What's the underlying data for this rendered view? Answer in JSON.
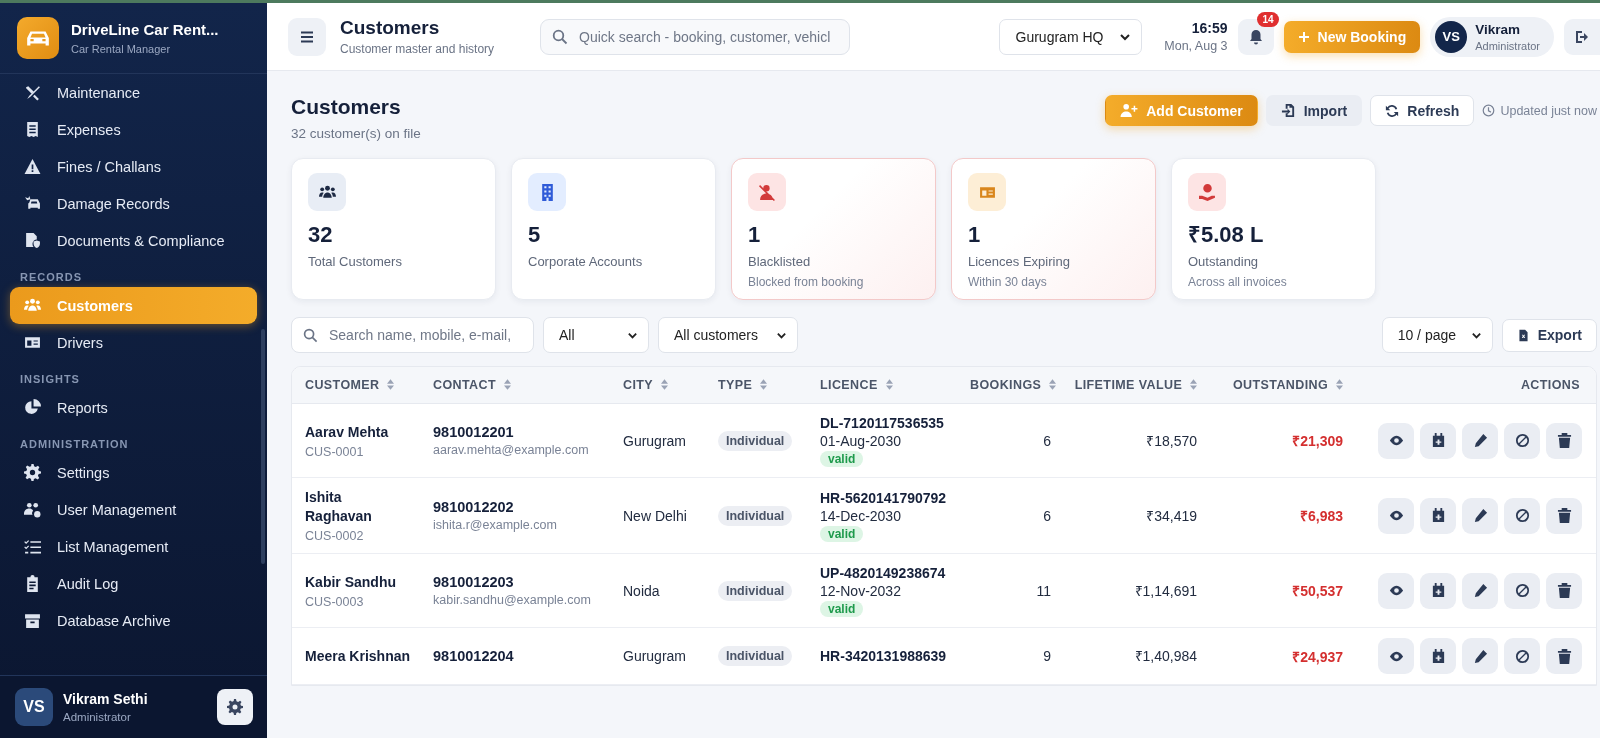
{
  "brand": {
    "title": "DriveLine Car Rent...",
    "subtitle": "Car Rental Manager"
  },
  "nav": [
    {
      "items": [
        {
          "label": "Maintenance",
          "selected": false
        },
        {
          "label": "Expenses",
          "selected": false
        },
        {
          "label": "Fines / Challans",
          "selected": false
        },
        {
          "label": "Damage Records",
          "selected": false
        },
        {
          "label": "Documents & Compliance",
          "selected": false
        }
      ]
    },
    {
      "heading": "RECORDS",
      "items": [
        {
          "label": "Customers",
          "selected": true
        },
        {
          "label": "Drivers",
          "selected": false
        }
      ]
    },
    {
      "heading": "INSIGHTS",
      "items": [
        {
          "label": "Reports",
          "selected": false
        }
      ]
    },
    {
      "heading": "ADMINISTRATION",
      "items": [
        {
          "label": "Settings",
          "selected": false
        },
        {
          "label": "User Management",
          "selected": false
        },
        {
          "label": "List Management",
          "selected": false
        },
        {
          "label": "Audit Log",
          "selected": false
        },
        {
          "label": "Database Archive",
          "selected": false
        }
      ]
    }
  ],
  "sidebar_user": {
    "initials": "VS",
    "name": "Vikram Sethi",
    "role": "Administrator"
  },
  "topbar": {
    "title": "Customers",
    "subtitle": "Customer master and history",
    "search_placeholder": "Quick search - booking, customer, vehicl",
    "location": "Gurugram HQ",
    "time": "16:59",
    "date": "Mon, Aug 3",
    "notifications": "14",
    "new_booking": "New Booking",
    "user": {
      "initials": "VS",
      "name": "Vikram",
      "role": "Administrator"
    }
  },
  "page": {
    "title": "Customers",
    "subtitle": "32 customer(s) on file",
    "add_button": "Add Customer",
    "import_button": "Import",
    "refresh_button": "Refresh",
    "updated": "Updated just now"
  },
  "stats": [
    {
      "value": "32",
      "label": "Total Customers",
      "highlighted": false
    },
    {
      "value": "5",
      "label": "Corporate Accounts",
      "highlighted": false
    },
    {
      "value": "1",
      "label": "Blacklisted",
      "note": "Blocked from booking",
      "highlighted": true
    },
    {
      "value": "1",
      "label": "Licences Expiring",
      "note": "Within 30 days",
      "highlighted": true
    },
    {
      "value": "₹5.08 L",
      "label": "Outstanding",
      "note": "Across all invoices",
      "highlighted": false
    }
  ],
  "filters": {
    "search_placeholder": "Search name, mobile, e-mail,",
    "type": "All",
    "segment": "All customers",
    "page_size": "10 / page",
    "export": "Export"
  },
  "table": {
    "columns": [
      {
        "label": "CUSTOMER",
        "sortable": true
      },
      {
        "label": "CONTACT",
        "sortable": true
      },
      {
        "label": "CITY",
        "sortable": true
      },
      {
        "label": "TYPE",
        "sortable": true
      },
      {
        "label": "LICENCE",
        "sortable": true
      },
      {
        "label": "BOOKINGS",
        "sortable": true
      },
      {
        "label": "LIFETIME VALUE",
        "sortable": true
      },
      {
        "label": "OUTSTANDING",
        "sortable": true
      },
      {
        "label": "ACTIONS",
        "sortable": false
      }
    ],
    "rows": [
      {
        "name": "Aarav Mehta",
        "id": "CUS-0001",
        "phone": "9810012201",
        "email": "aarav.mehta@example.com",
        "city": "Gurugram",
        "type": "Individual",
        "licence": "DL-7120117536535",
        "expiry": "01-Aug-2030",
        "status": "valid",
        "bookings": "6",
        "lifetime": "₹18,570",
        "outstanding": "₹21,309"
      },
      {
        "name": "Ishita Raghavan",
        "id": "CUS-0002",
        "phone": "9810012202",
        "email": "ishita.r@example.com",
        "city": "New Delhi",
        "type": "Individual",
        "licence": "HR-5620141790792",
        "expiry": "14-Dec-2030",
        "status": "valid",
        "bookings": "6",
        "lifetime": "₹34,419",
        "outstanding": "₹6,983"
      },
      {
        "name": "Kabir Sandhu",
        "id": "CUS-0003",
        "phone": "9810012203",
        "email": "kabir.sandhu@example.com",
        "city": "Noida",
        "type": "Individual",
        "licence": "UP-4820149238674",
        "expiry": "12-Nov-2032",
        "status": "valid",
        "bookings": "11",
        "lifetime": "₹1,14,691",
        "outstanding": "₹50,537"
      },
      {
        "name": "Meera Krishnan",
        "phone": "9810012204",
        "city": "Gurugram",
        "type": "Individual",
        "licence": "HR-3420131988639",
        "bookings": "9",
        "lifetime": "₹1,40,984",
        "outstanding": "₹24,937"
      }
    ]
  }
}
